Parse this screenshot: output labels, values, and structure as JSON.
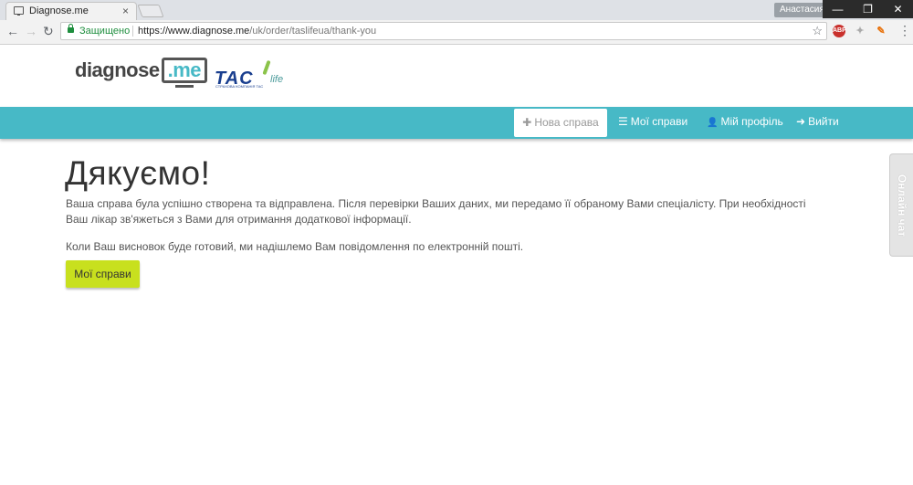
{
  "browser": {
    "tab_title": "Diagnose.me",
    "tab_close": "×",
    "user": "Анастасия",
    "window_buttons": [
      "—",
      "❐",
      "✕"
    ],
    "nav_back": "←",
    "nav_forward": "→",
    "nav_reload": "↻",
    "secure_label": "Защищено",
    "url_host": "https://www.diagnose.me",
    "url_path": "/uk/order/taslifeua/thank-you",
    "star": "☆",
    "menu": "⋮",
    "extensions": [
      {
        "name": "abp-icon",
        "label": "ABP",
        "color": "#c9302c"
      },
      {
        "name": "dropbox-icon",
        "label": "✦",
        "color": "#aaaaaa"
      },
      {
        "name": "extension-icon",
        "label": "✎",
        "color": "#e8710a"
      }
    ]
  },
  "header": {
    "logo_text": "diagnose",
    "logo_suffix": ".me",
    "partner_logo": "TAC",
    "partner_tagline": "СТРАХОВА КОМПАНІЯ ТАС",
    "partner_life": "life"
  },
  "nav": {
    "items": [
      {
        "label": "Нова справа",
        "icon": "plus-icon",
        "glyph": "✚"
      },
      {
        "label": "Мої справи",
        "icon": "list-icon",
        "glyph": "☰"
      },
      {
        "label": "Мій профіль",
        "icon": "user-icon",
        "glyph": "👤"
      },
      {
        "label": "Вийти",
        "icon": "logout-icon",
        "glyph": "➜"
      }
    ]
  },
  "main": {
    "heading": "Дякуємо!",
    "paragraph1_line1": "Ваша справа була успішно створена та відправлена. Після перевірки Ваших даних, ми передамо її обраному Вами спеціалісту. При необхідності",
    "paragraph1_line2": "Ваш лікар зв'яжеться з Вами для отримання додаткової інформації.",
    "paragraph2": "Коли Ваш висновок буде готовий, ми надішлемо Вам повідомлення по електронній пошті.",
    "button_label": "Мої справи"
  },
  "chat": {
    "label": "Онлайн чат"
  },
  "colors": {
    "accent": "#47b9c6",
    "button": "#c8e01e"
  }
}
